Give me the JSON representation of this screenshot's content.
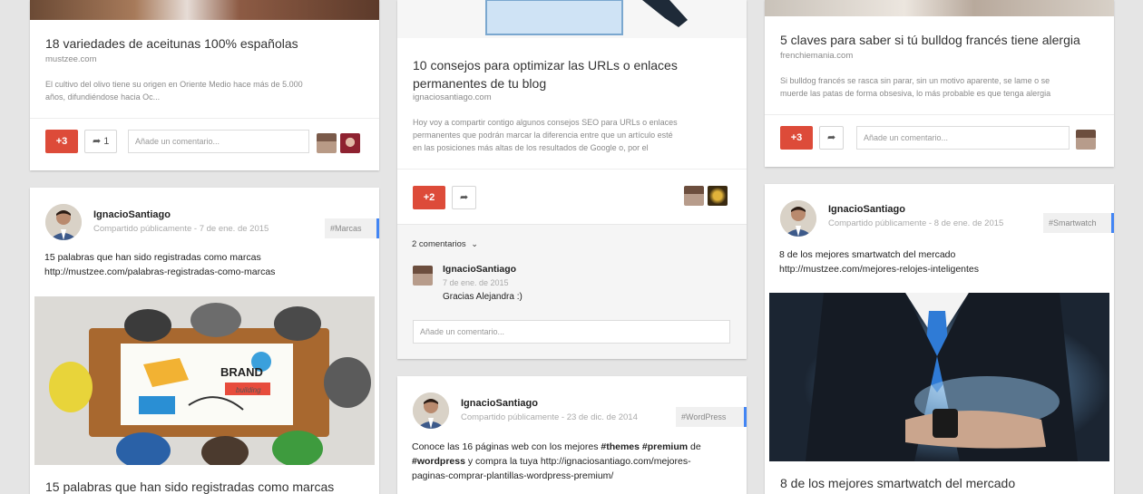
{
  "col1": {
    "card1": {
      "title": "18 variedades de aceitunas 100% españolas",
      "domain": "mustzee.com",
      "desc1": "El cultivo del olivo tiene su origen en Oriente Medio hace más de 5.000",
      "desc2": "años, difundiéndose hacia Oc...",
      "plus": "+3",
      "share_count": "1",
      "comment_placeholder": "Añade un comentario..."
    },
    "card2": {
      "user": "IgnacioSantiago",
      "meta": "Compartido públicamente  -  7 de ene. de 2015",
      "tag": "#Marcas",
      "text1": "15 palabras que han sido registradas como marcas",
      "text2": "http://mustzee.com/palabras-registradas-como-marcas",
      "image_word": "BRAND",
      "image_word2": "building",
      "link_title": "15 palabras que han sido registradas como marcas"
    }
  },
  "col2": {
    "card1": {
      "title1": "10 consejos para optimizar las URLs o enlaces",
      "title2": "permanentes de tu blog",
      "domain": "ignaciosantiago.com",
      "desc1": "Hoy voy a compartir contigo algunos consejos SEO para URLs o enlaces",
      "desc2": "permanentes que podrán marcar la diferencia entre que un artículo esté",
      "desc3": "en las posiciones más altas de los resultados de Google o, por el",
      "plus": "+2",
      "comments_toggle": "2 comentarios",
      "comment_user": "IgnacioSantiago",
      "comment_date": "7 de ene. de 2015",
      "comment_text": "Gracias Alejandra :)",
      "comment_placeholder": "Añade un comentario..."
    },
    "card2": {
      "user": "IgnacioSantiago",
      "meta": "Compartido públicamente  -  23 de dic. de 2014",
      "tag": "#WordPress",
      "t1a": "Conoce las 16 páginas web con los mejores ",
      "t1b": "#themes",
      "t1c": " ",
      "t1d": "#premium",
      "t1e": " de",
      "t2a": "#wordpress",
      "t2b": " y compra la tuya http://ignaciosantiago.com/mejores-",
      "t3": "paginas-comprar-plantillas-wordpress-premium/"
    }
  },
  "col3": {
    "card1": {
      "title": "5 claves para saber si tú bulldog francés tiene alergia",
      "domain": "frenchiemania.com",
      "desc1": "Si bulldog francés se rasca sin parar, sin un motivo aparente, se lame o se",
      "desc2": "muerde las patas de forma obsesiva, lo más probable es que tenga alergia",
      "plus": "+3",
      "comment_placeholder": "Añade un comentario..."
    },
    "card2": {
      "user": "IgnacioSantiago",
      "meta": "Compartido públicamente  -  8 de ene. de 2015",
      "tag": "#Smartwatch",
      "text1": "8 de los mejores smartwatch del mercado",
      "text2": "http://mustzee.com/mejores-relojes-inteligentes",
      "link_title": "8 de los mejores smartwatch del mercado"
    }
  },
  "colors": {
    "plus_red": "#dd4b39",
    "tag_blue": "#4285f4",
    "background": "#e5e5e5"
  }
}
